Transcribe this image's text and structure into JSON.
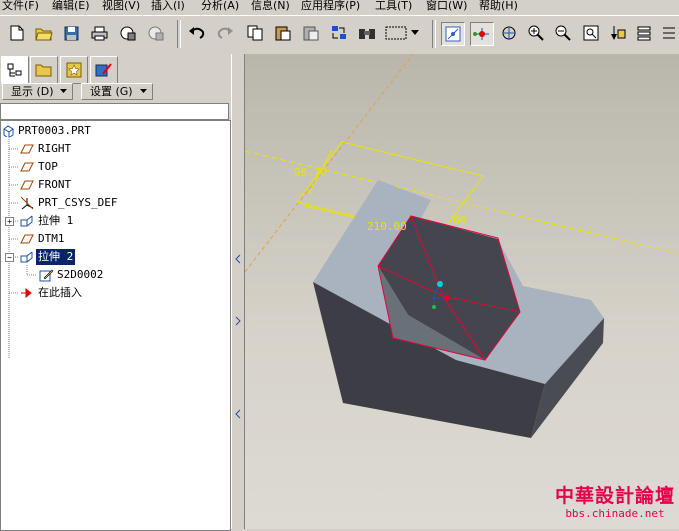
{
  "menu": [
    {
      "label": "文件(F)"
    },
    {
      "label": "编辑(E)"
    },
    {
      "label": "视图(V)"
    },
    {
      "label": "插入(I)"
    },
    {
      "label": "分析(A)"
    },
    {
      "label": "信息(N)"
    },
    {
      "label": "应用程序(P)"
    },
    {
      "label": "工具(T)"
    },
    {
      "label": "窗口(W)"
    },
    {
      "label": "帮助(H)"
    }
  ],
  "toolbar": {
    "icons": [
      "new-icon",
      "open-icon",
      "save-icon",
      "print-icon",
      "lock-icon",
      "pin-icon",
      "undo-icon",
      "redo-icon",
      "copy-icon",
      "paste-icon",
      "paste-special-icon",
      "regenerate-icon",
      "find-icon",
      "select-box-icon",
      "select-dropdown-icon",
      "spin-center-icon",
      "datum-display-icon",
      "orient-icon",
      "zoom-in-icon",
      "zoom-out-icon",
      "refit-icon",
      "view-manager-icon",
      "layers-icon"
    ]
  },
  "left_panel": {
    "display_button": "显示 (D)",
    "settings_button": "设置 (G)",
    "tree": [
      {
        "label": "PRT0003.PRT",
        "icon": "part-icon",
        "level": 0,
        "expander": false,
        "selected": false
      },
      {
        "label": "RIGHT",
        "icon": "datum-plane-icon",
        "level": 1,
        "expander": false,
        "selected": false
      },
      {
        "label": "TOP",
        "icon": "datum-plane-icon",
        "level": 1,
        "expander": false,
        "selected": false
      },
      {
        "label": "FRONT",
        "icon": "datum-plane-icon",
        "level": 1,
        "expander": false,
        "selected": false
      },
      {
        "label": "PRT_CSYS_DEF",
        "icon": "csys-icon",
        "level": 1,
        "expander": false,
        "selected": false
      },
      {
        "label": "拉伸 1",
        "icon": "extrude-icon",
        "level": 1,
        "expander": true,
        "selected": false
      },
      {
        "label": "DTM1",
        "icon": "datum-plane-icon",
        "level": 1,
        "expander": false,
        "selected": false
      },
      {
        "label": "拉伸 2",
        "icon": "extrude-icon",
        "level": 1,
        "expander": true,
        "selected": true
      },
      {
        "label": "S2D0002",
        "icon": "sketch-icon",
        "level": 2,
        "expander": false,
        "selected": false
      },
      {
        "label": "在此插入",
        "icon": "insert-arrow-icon",
        "level": 1,
        "expander": false,
        "selected": false
      }
    ]
  },
  "viewport": {
    "dim1": "96.70",
    "dim2": "210.00",
    "dim3": "60"
  },
  "watermark": {
    "title": "中華設計論壇",
    "url": "bbs.chinade.net"
  },
  "colors": {
    "background": "#d4d0c8",
    "selection": "#0a246a",
    "model_top": "#a9b3bf",
    "model_side": "#3d3e45",
    "datum_yellow": "#e6e600",
    "highlight_red": "#e8003c",
    "watermark_red": "#e6004c"
  }
}
